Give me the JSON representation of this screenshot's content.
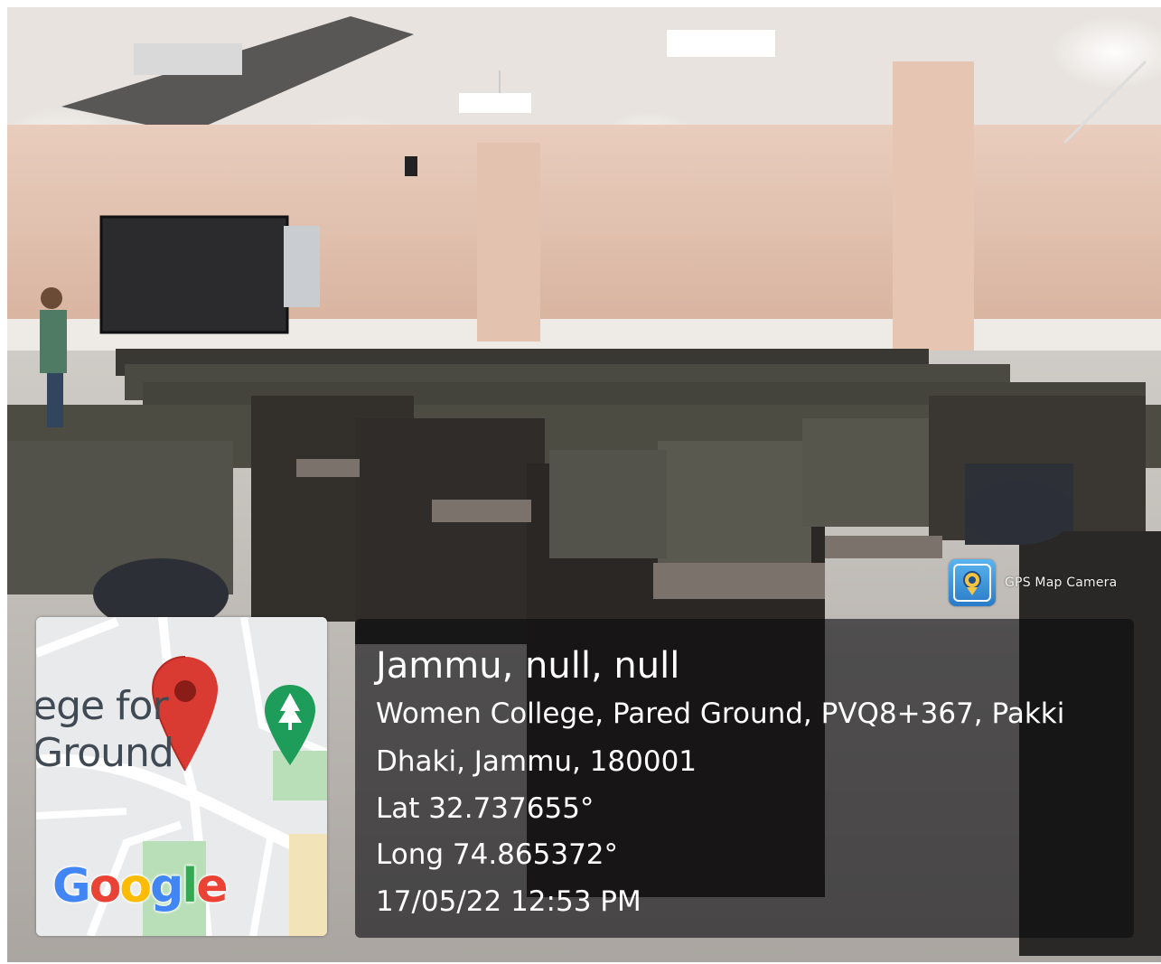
{
  "overlay": {
    "badge_label": "GPS Map Camera",
    "badge_icon": "gps-map-camera-icon"
  },
  "location": {
    "title": "Jammu, null, null",
    "address_line1": "Women College, Pared Ground, PVQ8+367, Pakki",
    "address_line2": "Dhaki, Jammu, 180001",
    "latitude": "Lat 32.737655°",
    "longitude": "Long 74.865372°",
    "datetime": "17/05/22 12:53 PM"
  },
  "map": {
    "label_line1": "ege for",
    "label_line2": "Ground",
    "pin_icon": "map-pin-icon",
    "park_icon": "tree-marker-icon",
    "attribution": "Google",
    "colors": {
      "pin": "#d93a32",
      "park_marker": "#1e9c5a",
      "park_area": "#b9dfb9",
      "road": "#ffffff",
      "land": "#e9eaec"
    }
  },
  "google_letters": [
    {
      "ch": "G",
      "color": "#4285F4"
    },
    {
      "ch": "o",
      "color": "#EA4335"
    },
    {
      "ch": "o",
      "color": "#FBBC05"
    },
    {
      "ch": "g",
      "color": "#4285F4"
    },
    {
      "ch": "l",
      "color": "#34A853"
    },
    {
      "ch": "e",
      "color": "#EA4335"
    }
  ]
}
